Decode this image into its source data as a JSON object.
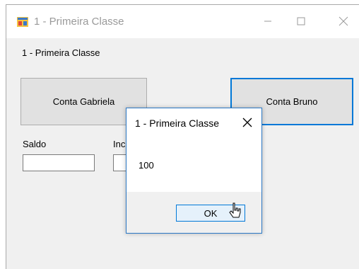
{
  "window": {
    "title": "1 - Primeira Classe",
    "icon": "winforms-app-icon",
    "controls": [
      "minimize-icon",
      "maximize-icon",
      "close-icon"
    ]
  },
  "form": {
    "label": "1 - Primeira Classe",
    "button_gabriela": "Conta Gabriela",
    "button_bruno": "Conta Bruno",
    "saldo_label": "Saldo",
    "second_label_partial": "Inc",
    "saldo_value": "",
    "second_value": ""
  },
  "dialog": {
    "title": "1 - Primeira Classe",
    "message": "100",
    "ok_label": "OK"
  },
  "colors": {
    "accent": "#0078d7",
    "window_bg": "#f0f0f0",
    "button_bg": "#e1e1e1",
    "ok_bg": "#e5f1fb"
  }
}
